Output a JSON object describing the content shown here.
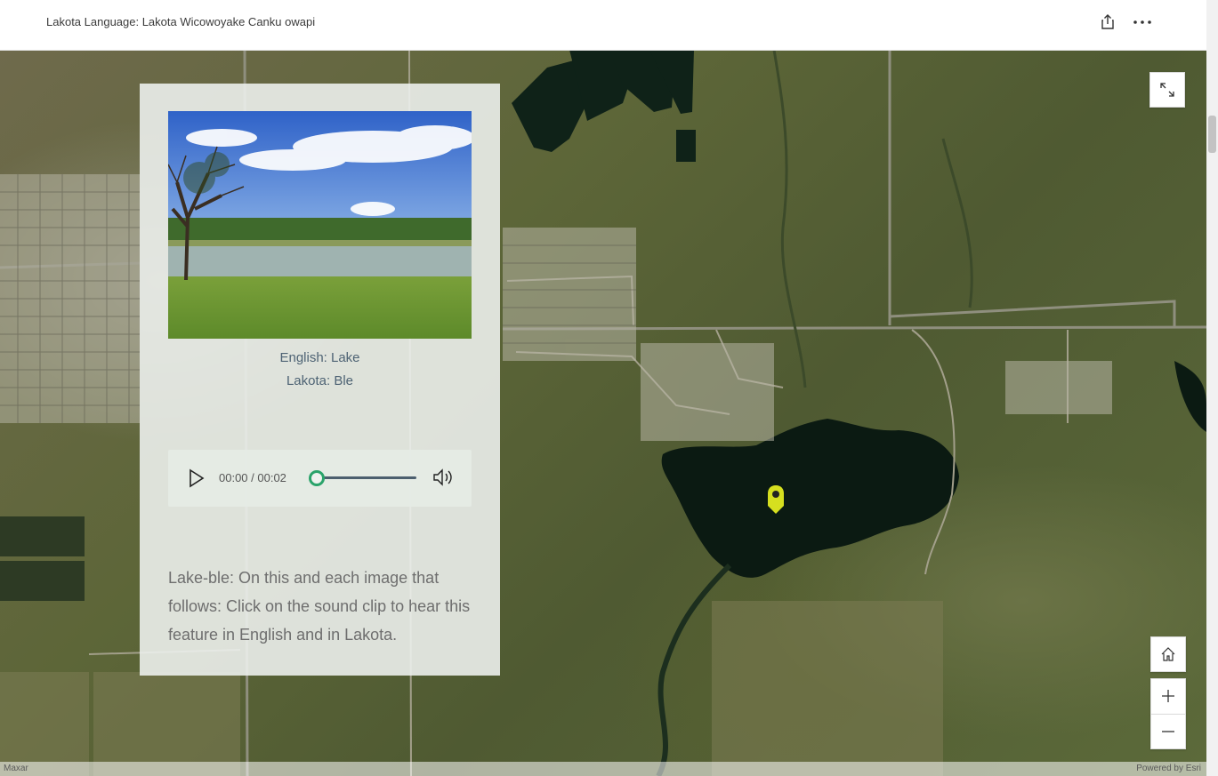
{
  "header": {
    "title": "Lakota Language: Lakota Wicowoyake Canku owapi",
    "share_icon": "share-icon",
    "more_icon": "ellipsis-icon"
  },
  "panel": {
    "english_line": "English:  Lake",
    "lakota_line": "Lakota:  Ble",
    "description": "Lake-ble:  On this and each image that follows: Click on the sound clip to hear this feature in English and in Lakota."
  },
  "audio": {
    "time": "00:00 / 00:02",
    "progress": 0,
    "play_icon": "play-icon",
    "volume_icon": "volume-icon"
  },
  "map_controls": {
    "fullscreen_icon": "expand-icon",
    "home_icon": "home-icon",
    "zoom_in_icon": "plus-icon",
    "zoom_out_icon": "minus-icon"
  },
  "attribution": {
    "left": "Maxar",
    "right": "Powered by Esri"
  },
  "colors": {
    "marker": "#d6df1f",
    "accent": "#2aa36a"
  }
}
